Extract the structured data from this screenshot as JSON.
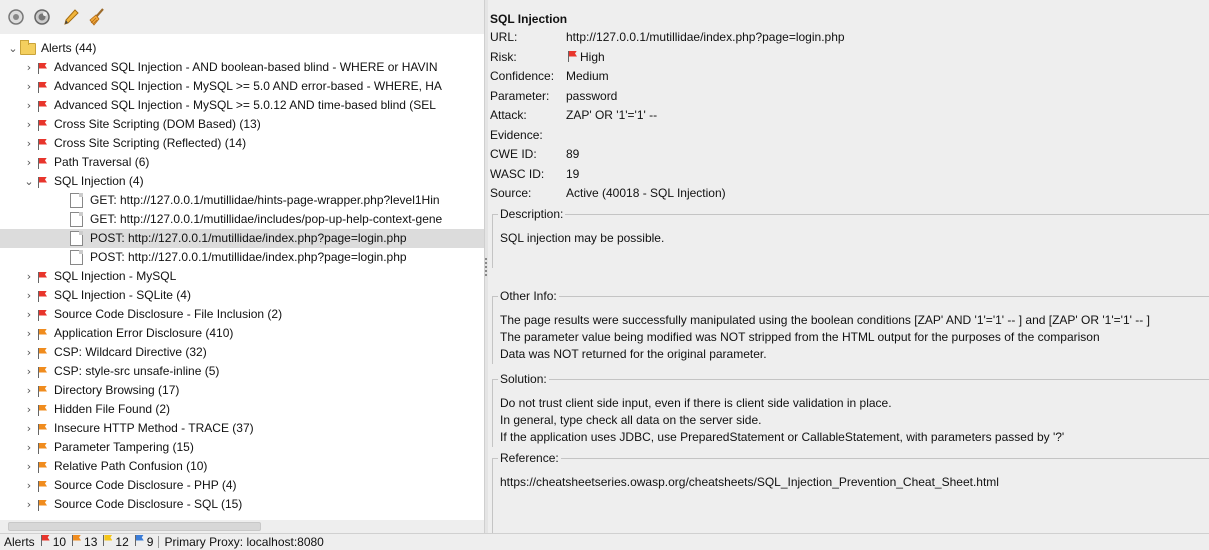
{
  "toolbar": {
    "icons": [
      "circle-target-icon",
      "globe-icon",
      "pencil-icon",
      "broom-icon"
    ]
  },
  "tree": {
    "root_label": "Alerts (44)",
    "items": [
      {
        "label": "Advanced SQL Injection - AND boolean-based blind - WHERE or HAVIN",
        "risk": "high",
        "expanded": false
      },
      {
        "label": "Advanced SQL Injection - MySQL >= 5.0 AND error-based - WHERE, HA",
        "risk": "high",
        "expanded": false
      },
      {
        "label": "Advanced SQL Injection - MySQL >= 5.0.12 AND time-based blind (SEL",
        "risk": "high",
        "expanded": false
      },
      {
        "label": "Cross Site Scripting (DOM Based) (13)",
        "risk": "high",
        "expanded": false
      },
      {
        "label": "Cross Site Scripting (Reflected) (14)",
        "risk": "high",
        "expanded": false
      },
      {
        "label": "Path Traversal (6)",
        "risk": "high",
        "expanded": false
      },
      {
        "label": "SQL Injection (4)",
        "risk": "high",
        "expanded": true
      },
      {
        "label": "GET: http://127.0.0.1/mutillidae/hints-page-wrapper.php?level1Hin",
        "child": true
      },
      {
        "label": "GET: http://127.0.0.1/mutillidae/includes/pop-up-help-context-gene",
        "child": true
      },
      {
        "label": "POST: http://127.0.0.1/mutillidae/index.php?page=login.php",
        "child": true,
        "selected": true
      },
      {
        "label": "POST: http://127.0.0.1/mutillidae/index.php?page=login.php",
        "child": true
      },
      {
        "label": "SQL Injection - MySQL",
        "risk": "high",
        "expanded": false
      },
      {
        "label": "SQL Injection - SQLite (4)",
        "risk": "high",
        "expanded": false
      },
      {
        "label": "Source Code Disclosure - File Inclusion (2)",
        "risk": "high",
        "expanded": false
      },
      {
        "label": "Application Error Disclosure (410)",
        "risk": "medium",
        "expanded": false
      },
      {
        "label": "CSP: Wildcard Directive (32)",
        "risk": "medium",
        "expanded": false
      },
      {
        "label": "CSP: style-src unsafe-inline (5)",
        "risk": "medium",
        "expanded": false
      },
      {
        "label": "Directory Browsing (17)",
        "risk": "medium",
        "expanded": false
      },
      {
        "label": "Hidden File Found (2)",
        "risk": "medium",
        "expanded": false
      },
      {
        "label": "Insecure HTTP Method - TRACE (37)",
        "risk": "medium",
        "expanded": false
      },
      {
        "label": "Parameter Tampering (15)",
        "risk": "medium",
        "expanded": false
      },
      {
        "label": "Relative Path Confusion (10)",
        "risk": "medium",
        "expanded": false
      },
      {
        "label": "Source Code Disclosure - PHP (4)",
        "risk": "medium",
        "expanded": false
      },
      {
        "label": "Source Code Disclosure - SQL (15)",
        "risk": "medium",
        "expanded": false
      }
    ]
  },
  "detail": {
    "title": "SQL Injection",
    "fields": [
      {
        "key": "URL:",
        "value": "http://127.0.0.1/mutillidae/index.php?page=login.php"
      },
      {
        "key": "Risk:",
        "value": "High",
        "flag": true
      },
      {
        "key": "Confidence:",
        "value": "Medium"
      },
      {
        "key": "Parameter:",
        "value": "password"
      },
      {
        "key": "Attack:",
        "value": "ZAP' OR '1'='1' --"
      },
      {
        "key": "Evidence:",
        "value": ""
      },
      {
        "key": "CWE ID:",
        "value": "89"
      },
      {
        "key": "WASC ID:",
        "value": "19"
      },
      {
        "key": "Source:",
        "value": "Active (40018 - SQL Injection)"
      }
    ],
    "description": {
      "label": "Description:",
      "lines": [
        "SQL injection may be possible."
      ]
    },
    "other_info": {
      "label": "Other Info:",
      "lines": [
        "The page results were successfully manipulated using the boolean conditions [ZAP' AND '1'='1' -- ] and [ZAP' OR '1'='1' -- ]",
        "The parameter value being modified was NOT stripped from the HTML output for the purposes of the comparison",
        "Data was NOT returned for the original parameter."
      ]
    },
    "solution": {
      "label": "Solution:",
      "lines": [
        "Do not trust client side input, even if there is client side validation in place.",
        "In general, type check all data on the server side.",
        "If the application uses JDBC, use PreparedStatement or CallableStatement, with parameters passed by '?'"
      ]
    },
    "reference": {
      "label": "Reference:",
      "lines": [
        "https://cheatsheetseries.owasp.org/cheatsheets/SQL_Injection_Prevention_Cheat_Sheet.html"
      ]
    }
  },
  "status": {
    "alerts_label": "Alerts",
    "counts": [
      {
        "value": "10",
        "color": "#e8352c"
      },
      {
        "value": "13",
        "color": "#f08c1e"
      },
      {
        "value": "12",
        "color": "#f5c518"
      },
      {
        "value": "9",
        "color": "#3b7dd8"
      }
    ],
    "proxy": "Primary Proxy: localhost:8080"
  },
  "colors": {
    "high": "#e8352c",
    "medium": "#f08c1e"
  }
}
